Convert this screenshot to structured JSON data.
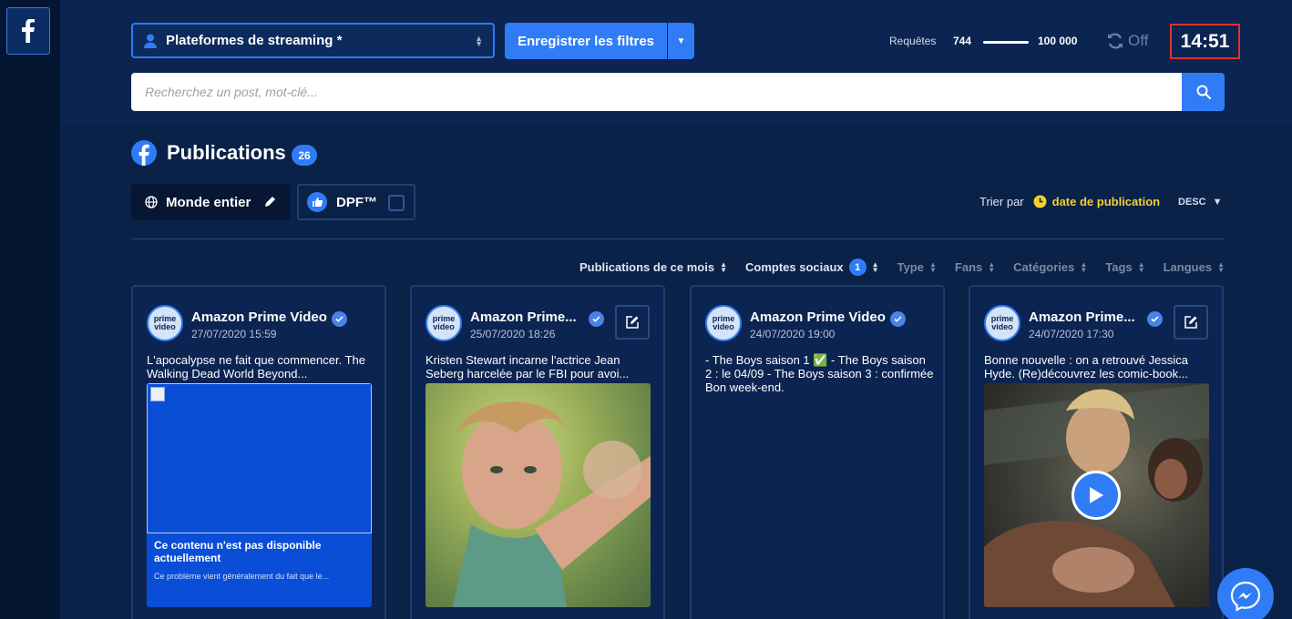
{
  "sidebar": {
    "network_icon": "facebook-icon"
  },
  "header": {
    "profile_select_value": "Plateformes de streaming *",
    "save_button": "Enregistrer les filtres",
    "requests_label": "Requêtes",
    "requests_used": "744",
    "requests_total": "100 000",
    "requests_fraction": 0.0074,
    "refresh_state": "Off",
    "clock": "14:51"
  },
  "search": {
    "placeholder": "Recherchez un post, mot-clé..."
  },
  "publications": {
    "title": "Publications",
    "count": "26",
    "scope_chip": "Monde entier",
    "dpf_chip": "DPF™",
    "sort_label": "Trier par",
    "sort_field": "date de publication",
    "sort_direction": "DESC"
  },
  "filters": [
    {
      "label": "Publications de ce mois",
      "active": true
    },
    {
      "label": "Comptes sociaux",
      "active": true,
      "count": "1"
    },
    {
      "label": "Type",
      "active": false
    },
    {
      "label": "Fans",
      "active": false
    },
    {
      "label": "Catégories",
      "active": false
    },
    {
      "label": "Tags",
      "active": false
    },
    {
      "label": "Langues",
      "active": false
    }
  ],
  "cards": [
    {
      "account": "Amazon Prime Video",
      "date": "27/07/2020 15:59",
      "text": "L'apocalypse ne fait que commencer. The Walking Dead World Beyond...",
      "unavailable_title": "Ce contenu n'est pas disponible actuellement",
      "unavailable_detail": "Ce problème vient généralement du fait que le..."
    },
    {
      "account": "Amazon Prime...",
      "date": "25/07/2020 18:26",
      "text": "Kristen Stewart incarne l'actrice Jean Seberg harcelée par le FBI pour avoi..."
    },
    {
      "account": "Amazon Prime Video",
      "date": "24/07/2020 19:00",
      "text": "- The Boys saison 1 ✅ - The Boys saison 2 : le 04/09 - The Boys saison 3 : confirmée Bon week-end."
    },
    {
      "account": "Amazon Prime...",
      "date": "24/07/2020 17:30",
      "text": "Bonne nouvelle : on a retrouvé Jessica Hyde. (Re)découvrez les comic-book..."
    }
  ],
  "logo_text": {
    "line1": "prime",
    "line2": "video"
  },
  "colors": {
    "accent": "#2f7cf6",
    "background": "#0a2148",
    "clock_border": "#e0322e",
    "sort_field": "#f5cf2f"
  }
}
